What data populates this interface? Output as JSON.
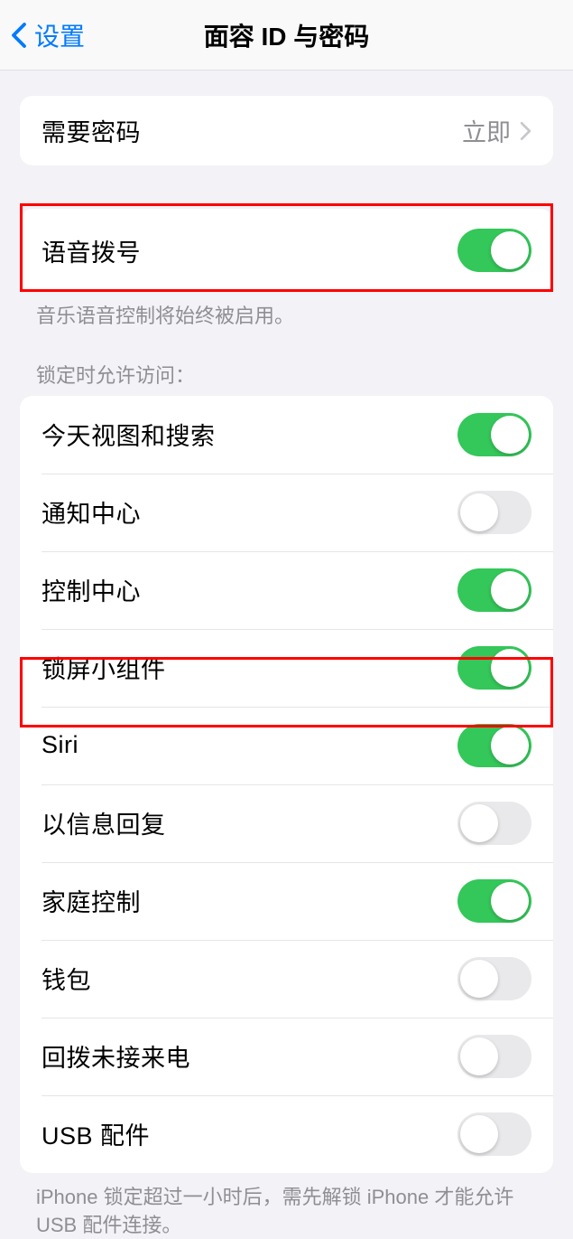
{
  "navbar": {
    "back_label": "设置",
    "title": "面容 ID 与密码"
  },
  "require_passcode": {
    "label": "需要密码",
    "value": "立即"
  },
  "voice_dial": {
    "label": "语音拨号",
    "enabled": true,
    "footer": "音乐语音控制将始终被启用。"
  },
  "lock_access": {
    "header": "锁定时允许访问：",
    "items": [
      {
        "label": "今天视图和搜索",
        "enabled": true
      },
      {
        "label": "通知中心",
        "enabled": false
      },
      {
        "label": "控制中心",
        "enabled": true
      },
      {
        "label": "锁屏小组件",
        "enabled": true
      },
      {
        "label": "Siri",
        "enabled": true
      },
      {
        "label": "以信息回复",
        "enabled": false
      },
      {
        "label": "家庭控制",
        "enabled": true
      },
      {
        "label": "钱包",
        "enabled": false
      },
      {
        "label": "回拨未接来电",
        "enabled": false
      },
      {
        "label": "USB 配件",
        "enabled": false
      }
    ],
    "footer": "iPhone 锁定超过一小时后，需先解锁 iPhone 才能允许 USB 配件连接。"
  }
}
